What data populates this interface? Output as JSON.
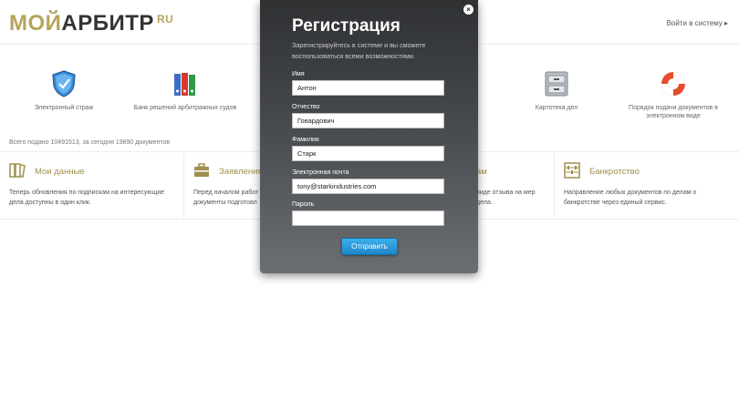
{
  "header": {
    "logo_word1": "МОЙ",
    "logo_word2": "АРБИТР",
    "logo_tld": "RU",
    "login_link": "Войти в систему ▸"
  },
  "services": [
    {
      "label": "Электронный страж",
      "icon": "shield-icon"
    },
    {
      "label": "Банк решений арбитражных судов",
      "icon": "binders-icon"
    },
    {
      "label": "Картотека дел",
      "icon": "file-cabinet-icon"
    },
    {
      "label": "Порядок подачи документов в электронном виде",
      "icon": "lifebuoy-icon"
    }
  ],
  "counter": "Всего подано 10491513, за сегодня 19890 документов",
  "cards": [
    {
      "title": "Мои данные",
      "desc": "Теперь обновления по подпискам на интересующие дела доступны в один клик.",
      "icon": "folders-icon"
    },
    {
      "title": "Заявления",
      "desc": "Перед началом работ документы подготовл",
      "icon": "briefcase-icon"
    },
    {
      "title": "ам",
      "desc": "виде отзыва на мер дела.",
      "icon": ""
    },
    {
      "title": "Банкротство",
      "desc": "Направление любых документов по делам о банкротстве через единый сервис.",
      "icon": "abacus-icon"
    }
  ],
  "modal": {
    "title": "Регистрация",
    "subtitle": "Зарегистрируйтесь в системе и вы сможете воспользоваться всеми возможностями.",
    "fields": [
      {
        "label": "Имя",
        "value": "Антон"
      },
      {
        "label": "Отчество",
        "value": "Говардович"
      },
      {
        "label": "Фамилия",
        "value": "Старк"
      },
      {
        "label": "Электронная почта",
        "value": "tony@starkindustries.com"
      },
      {
        "label": "Пароль",
        "value": ""
      }
    ],
    "submit": "Отправить",
    "close": "×"
  },
  "colors": {
    "brand_gold": "#b5a45a",
    "modal_dark": "#2f3133",
    "button_blue": "#1d86c8"
  }
}
